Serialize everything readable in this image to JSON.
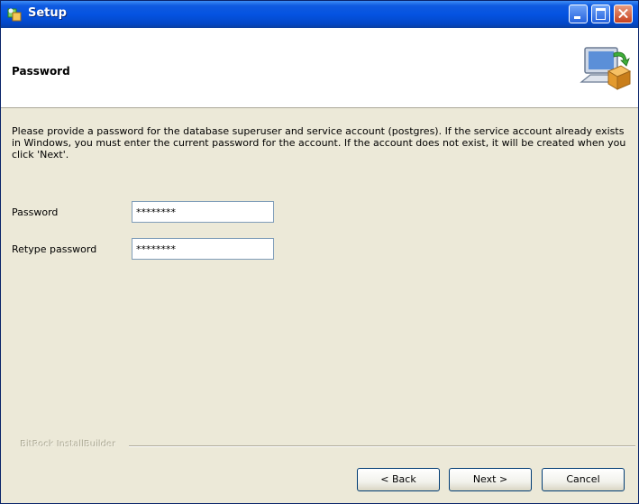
{
  "window": {
    "title": "Setup",
    "minimize_icon": "minimize-icon",
    "maximize_icon": "maximize-icon",
    "close_icon": "close-icon"
  },
  "header": {
    "title": "Password",
    "icon": "computer-install-icon"
  },
  "content": {
    "description": "Please provide a password for the database superuser and service account (postgres). If the service account already exists in Windows, you must enter the current password for the account. If the account does not exist, it will be created when you click 'Next'.",
    "fields": [
      {
        "label": "Password",
        "value": "********"
      },
      {
        "label": "Retype password",
        "value": "********"
      }
    ]
  },
  "footer": {
    "brand": "BitRock InstallBuilder",
    "back_label": "< Back",
    "next_label": "Next >",
    "cancel_label": "Cancel"
  },
  "colors": {
    "titlebar": "#0553e1",
    "background": "#ece9d8",
    "header_background": "#ffffff",
    "input_border": "#7f9db9"
  }
}
